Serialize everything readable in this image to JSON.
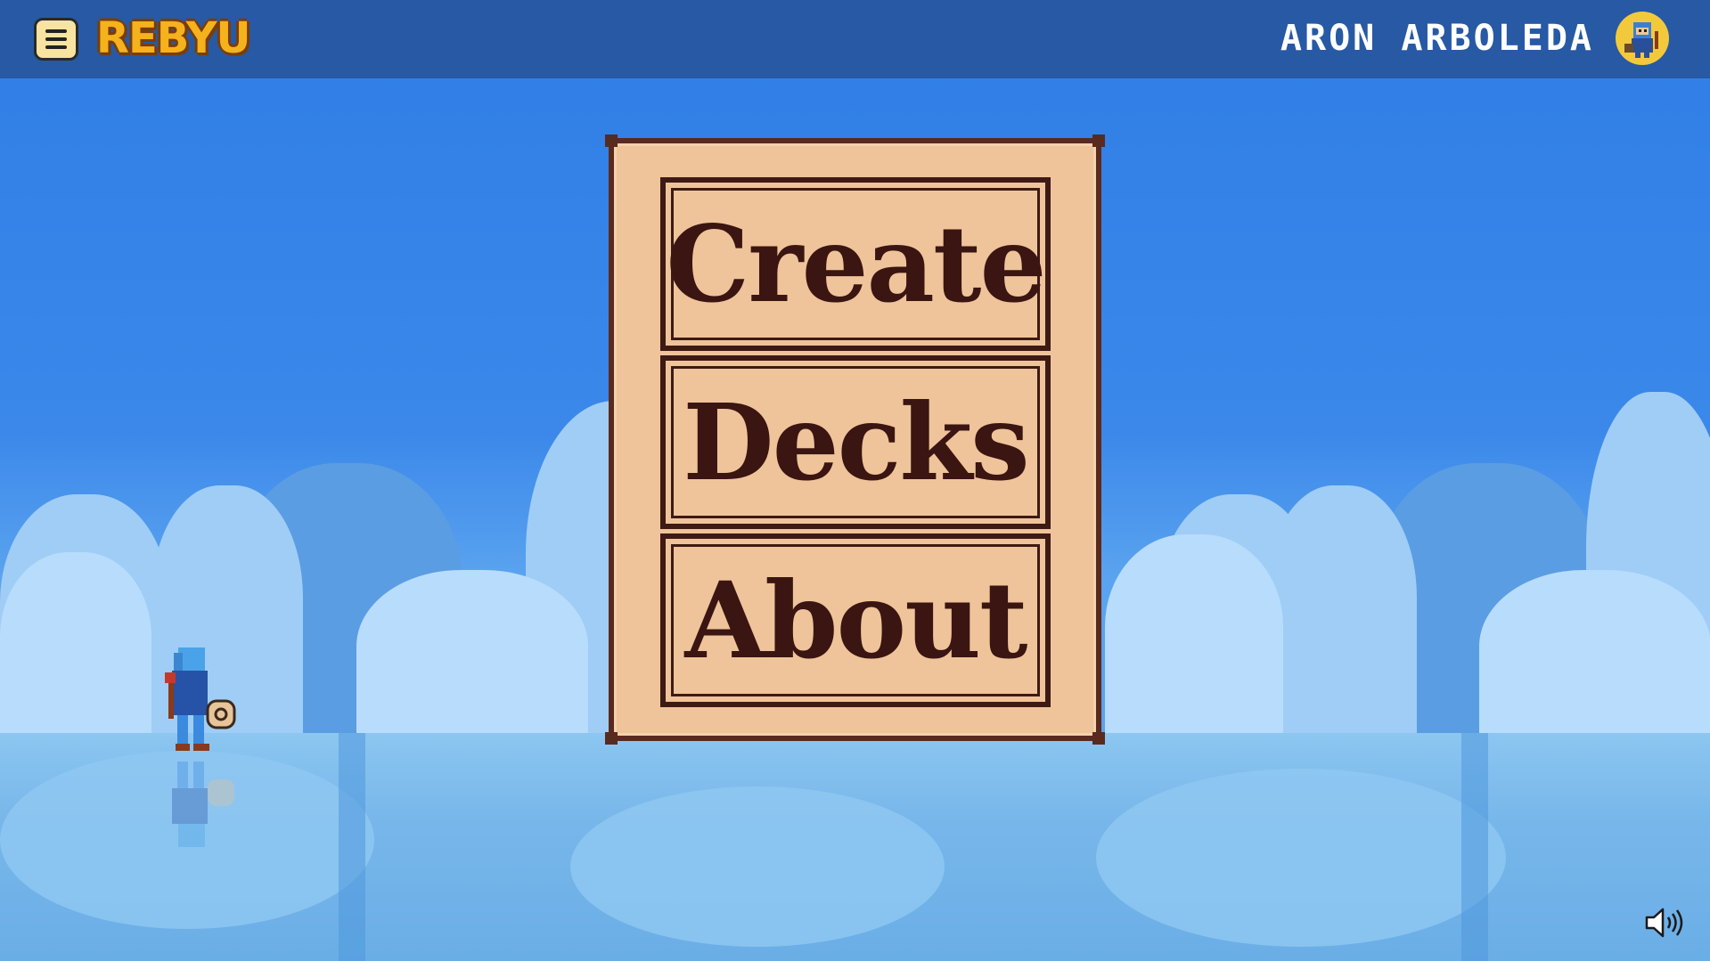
{
  "header": {
    "logo_text": "REBYU",
    "username": "ARON ARBOLEDA",
    "menu_icon": "hamburger-menu-icon",
    "avatar_icon": "user-avatar-icon"
  },
  "menu": {
    "items": [
      {
        "label": "Create"
      },
      {
        "label": "Decks"
      },
      {
        "label": "About"
      }
    ]
  },
  "controls": {
    "sound_icon": "speaker-volume-icon"
  },
  "colors": {
    "topbar": "#2759a5",
    "sky": "#3a84e8",
    "board": "#efc49a",
    "board_ink": "#3a1512",
    "logo": "#f5b21c",
    "username": "#ffffff"
  }
}
